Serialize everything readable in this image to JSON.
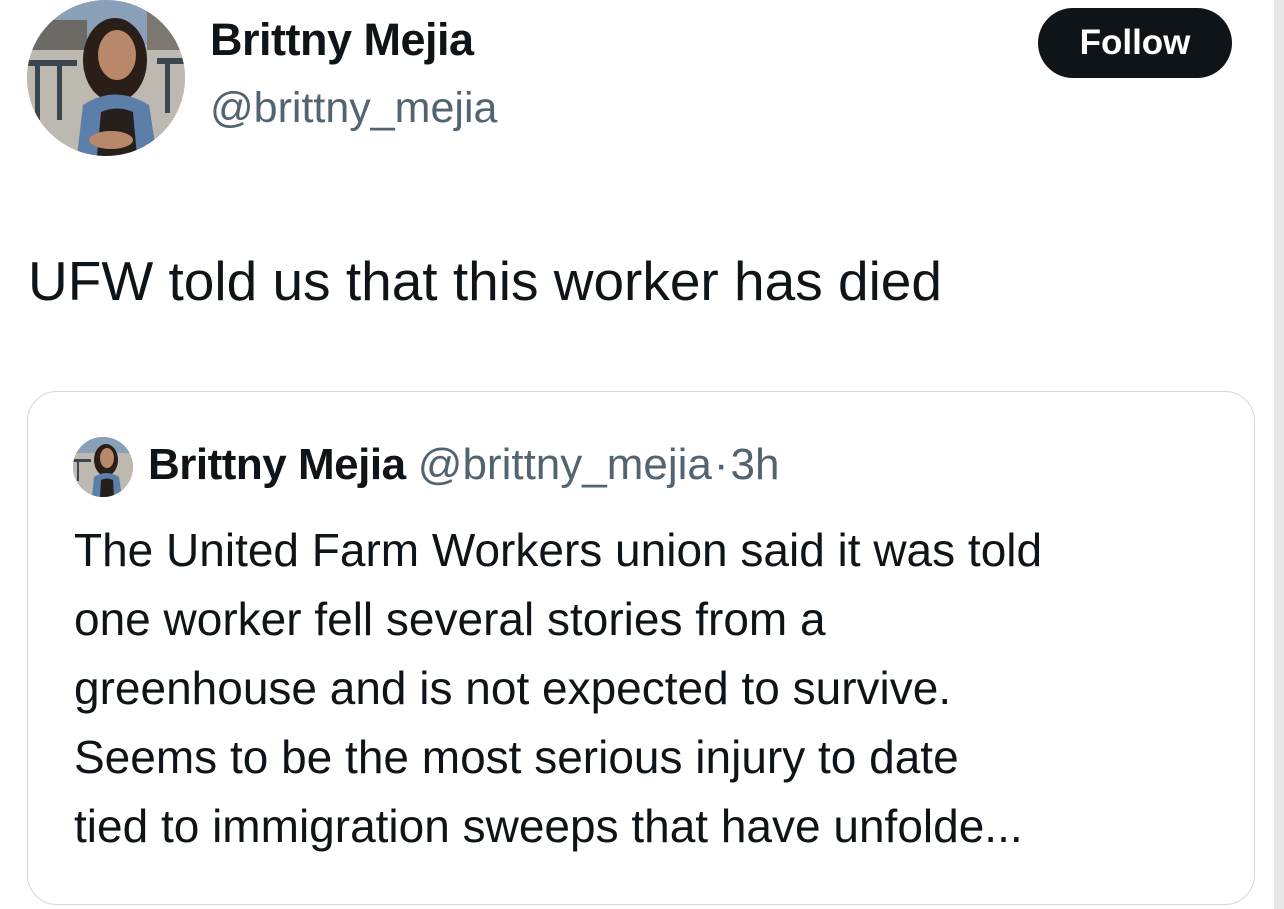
{
  "tweet": {
    "author_name": "Brittny Mejia",
    "author_handle": "@brittny_mejia",
    "follow_label": "Follow",
    "text": "UFW told us that this worker has died"
  },
  "quoted_tweet": {
    "author_name": "Brittny Mejia",
    "author_handle": "@brittny_mejia",
    "separator": "·",
    "time": "3h",
    "lines": [
      "The United Farm Workers union said it was told",
      "one worker fell several stories from a",
      "greenhouse and is not expected to survive.",
      "Seems to be the most serious injury to date",
      "tied to immigration sweeps that have unfolde..."
    ]
  },
  "icons": {
    "avatar": "profile-photo",
    "quote_avatar": "profile-photo-small"
  },
  "colors": {
    "text_primary": "#0f1419",
    "text_secondary": "#536471",
    "follow_button_bg": "#0f1419",
    "follow_button_text": "#ffffff",
    "card_border": "#cfd9de"
  }
}
